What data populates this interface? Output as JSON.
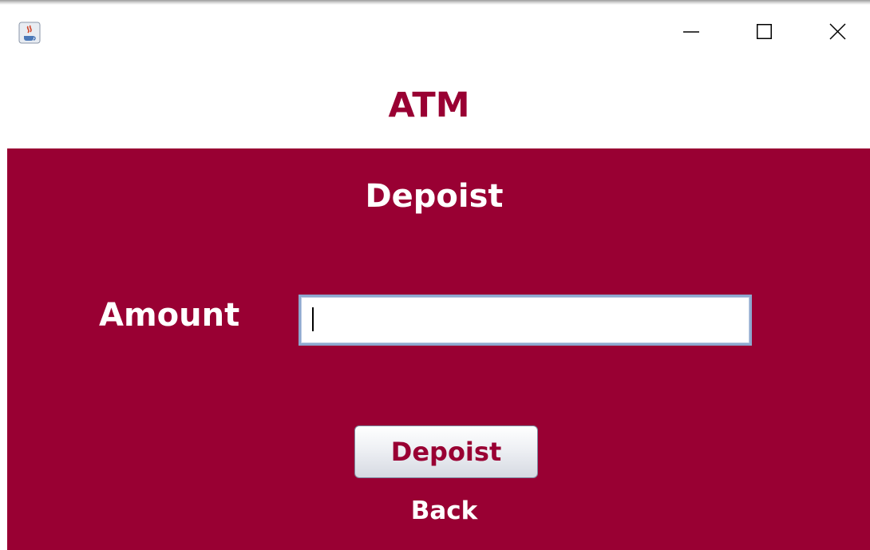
{
  "window": {
    "title": "",
    "icon": "java-app-icon",
    "controls": {
      "minimize_icon": "minimize-icon",
      "maximize_icon": "maximize-icon",
      "close_icon": "close-icon"
    }
  },
  "header": {
    "title": "ATM"
  },
  "panel": {
    "title": "Depoist",
    "amount_label": "Amount",
    "amount_value": "",
    "deposit_button": "Depoist",
    "back_link": "Back"
  },
  "colors": {
    "brand": "#990033",
    "text_on_brand": "#ffffff"
  }
}
